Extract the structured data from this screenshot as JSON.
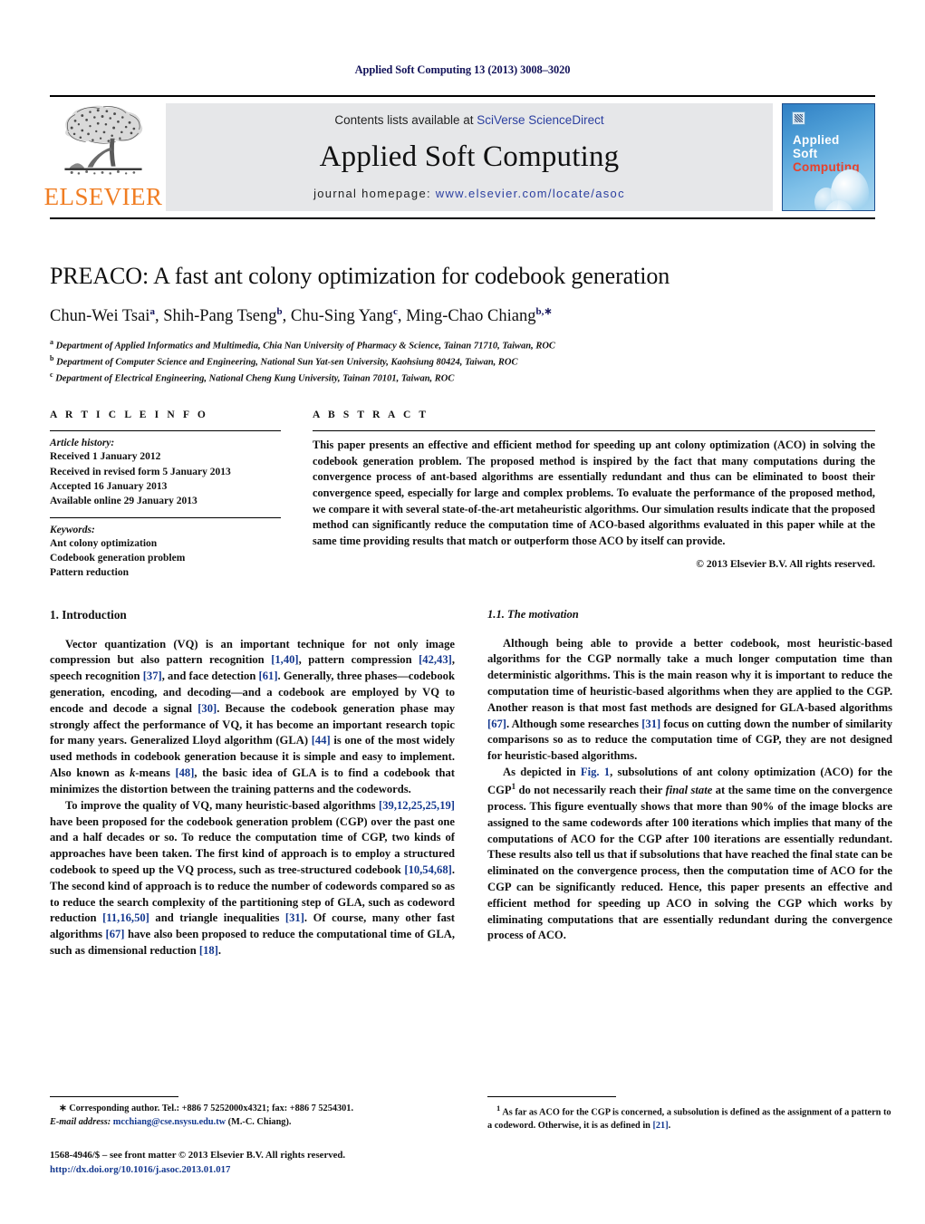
{
  "running_head": "Applied Soft Computing 13 (2013) 3008–3020",
  "masthead": {
    "publisher_name": "ELSEVIER",
    "contents_prefix": "Contents lists available at ",
    "contents_link": "SciVerse ScienceDirect",
    "journal_title": "Applied Soft Computing",
    "homepage_prefix": "journal homepage: ",
    "homepage_link": "www.elsevier.com/locate/asoc",
    "cover": {
      "line1": "Applied",
      "line2": "Soft",
      "line3": "Computing"
    }
  },
  "article": {
    "title": "PREACO: A fast ant colony optimization for codebook generation",
    "authors_html": "Chun-Wei Tsai<sup>a</sup>, Shih-Pang Tseng<sup>b</sup>, Chu-Sing Yang<sup>c</sup>, Ming-Chao Chiang<sup>b,∗</sup>",
    "affiliations": [
      "Department of Applied Informatics and Multimedia, Chia Nan University of Pharmacy & Science, Tainan 71710, Taiwan, ROC",
      "Department of Computer Science and Engineering, National Sun Yat-sen University, Kaohsiung 80424, Taiwan, ROC",
      "Department of Electrical Engineering, National Cheng Kung University, Tainan 70101, Taiwan, ROC"
    ],
    "affiliation_marks": [
      "a",
      "b",
      "c"
    ]
  },
  "article_info": {
    "heading": "A R T I C L E    I N F O",
    "history_label": "Article history:",
    "history": [
      "Received 1 January 2012",
      "Received in revised form 5 January 2013",
      "Accepted 16 January 2013",
      "Available online 29 January 2013"
    ],
    "keywords_label": "Keywords:",
    "keywords": [
      "Ant colony optimization",
      "Codebook generation problem",
      "Pattern reduction"
    ]
  },
  "abstract": {
    "heading": "A B S T R A C T",
    "body": "This paper presents an effective and efficient method for speeding up ant colony optimization (ACO) in solving the codebook generation problem. The proposed method is inspired by the fact that many computations during the convergence process of ant-based algorithms are essentially redundant and thus can be eliminated to boost their convergence speed, especially for large and complex problems. To evaluate the performance of the proposed method, we compare it with several state-of-the-art metaheuristic algorithms. Our simulation results indicate that the proposed method can significantly reduce the computation time of ACO-based algorithms evaluated in this paper while at the same time providing results that match or outperform those ACO by itself can provide.",
    "copyright": "© 2013 Elsevier B.V. All rights reserved."
  },
  "sections": {
    "intro_heading": "1.  Introduction",
    "motivation_heading": "1.1.  The motivation"
  },
  "footnotes": {
    "corresponding": "Corresponding author. Tel.: +886 7 5252000x4321; fax: +886 7 5254301.",
    "email_label": "E-mail address:",
    "email": "mcchiang@cse.nsysu.edu.tw",
    "email_suffix": "(M.-C. Chiang).",
    "issn_line": "1568-4946/$ – see front matter © 2013 Elsevier B.V. All rights reserved.",
    "doi": "http://dx.doi.org/10.1016/j.asoc.2013.01.017",
    "note1_marker": "1",
    "note1_text_a": "As far as ACO for the CGP is concerned, a subsolution is defined as the assignment of a pattern to a codeword. Otherwise, it is as defined in ",
    "note1_ref": "[21]",
    "note1_text_b": "."
  },
  "colors": {
    "link": "#2b3fa0",
    "citation": "#14388f",
    "elsevier_orange": "#f07d22",
    "cover_red": "#e8402a",
    "banner_bg": "#e6e7e9"
  }
}
